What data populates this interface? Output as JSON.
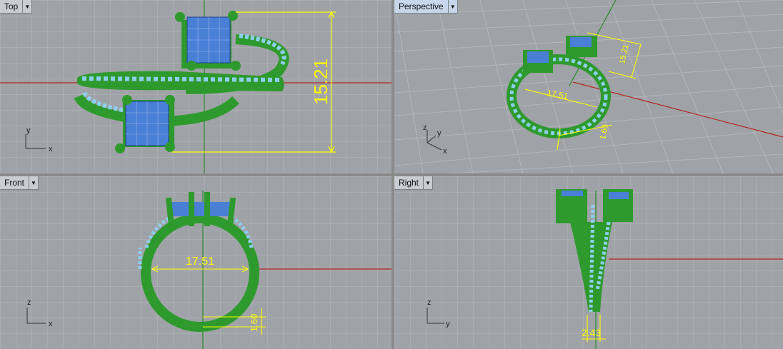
{
  "viewports": {
    "top": {
      "title": "Top"
    },
    "perspective": {
      "title": "Perspective"
    },
    "front": {
      "title": "Front"
    },
    "right": {
      "title": "Right"
    }
  },
  "dimensions": {
    "top_height": "15.21",
    "persp_height": "15.21",
    "persp_width": "17.51",
    "persp_band": "1.60",
    "front_width": "17.51",
    "front_band": "1.60",
    "right_width": "2.43"
  },
  "axes": {
    "x": "x",
    "y": "y",
    "z": "z"
  },
  "colors": {
    "dimension": "#ffff00",
    "metal": "#2e9a2e",
    "stone": "#4a7fd6",
    "pave": "#8ed0f0"
  }
}
